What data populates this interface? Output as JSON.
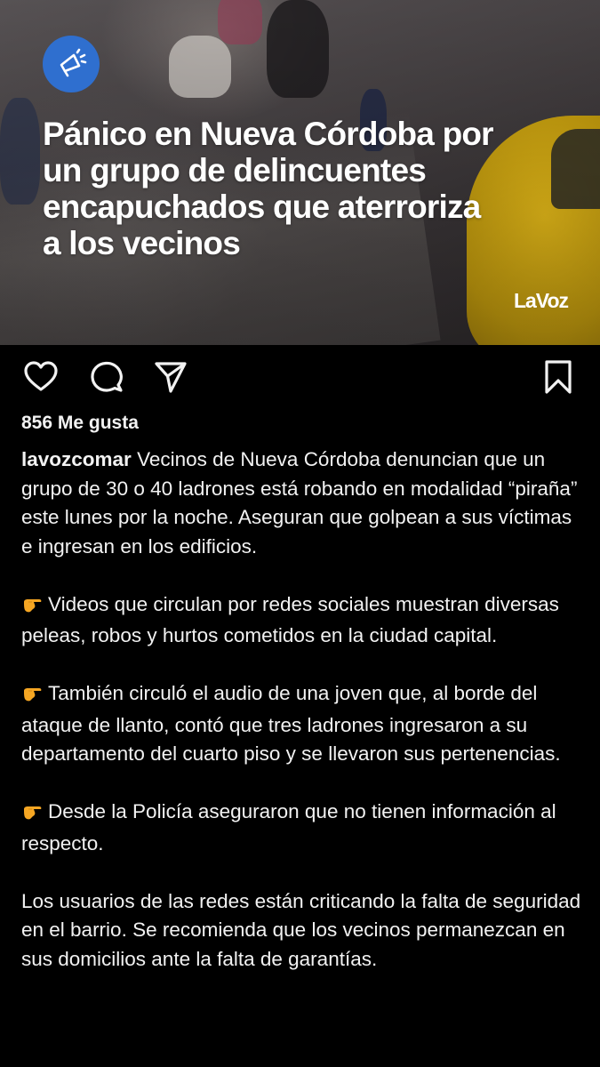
{
  "post": {
    "headline_lines": [
      "Pánico en Nueva Córdoba por",
      "un grupo de delincuentes",
      "encapuchados que aterroriza",
      "a los vecinos"
    ],
    "brand": "LaVoz",
    "badge_icon": "megaphone-icon",
    "badge_color": "#2f6fcf"
  },
  "actions": {
    "icons": [
      "heart-icon",
      "comment-icon",
      "share-icon",
      "bookmark-icon"
    ]
  },
  "likes_text": "856 Me gusta",
  "caption": {
    "username": "lavozcomar",
    "intro": " Vecinos de Nueva Córdoba denuncian que un grupo de 30 o 40 ladrones está robando en modalidad “piraña” este lunes por la noche. Aseguran que golpean a sus víctimas e ingresan en los edificios.",
    "point_icon": "pointing-hand-icon",
    "points": [
      "Videos que circulan por redes sociales muestran diversas peleas, robos y hurtos cometidos en la ciudad capital.",
      "También circuló el audio de una joven que, al borde del ataque de llanto, contó que tres ladrones ingresaron a su departamento del cuarto piso y se llevaron sus pertenencias.",
      "Desde la Policía aseguraron que no tienen información al respecto."
    ],
    "closing": "Los usuarios de las redes están criticando la falta de seguridad en el barrio. Se recomienda que los vecinos permanezcan en sus domicilios ante la falta de garantías."
  }
}
